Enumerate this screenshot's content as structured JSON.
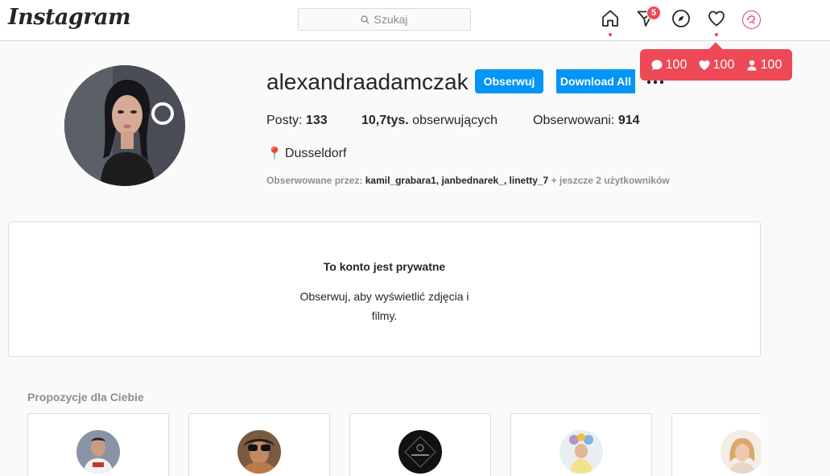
{
  "nav": {
    "logo": "Instagram",
    "search_placeholder": "Szukaj",
    "messages_badge": "5",
    "icons": [
      "home-icon",
      "direct-icon",
      "explore-icon",
      "activity-heart-icon",
      "profile-avatar-icon"
    ]
  },
  "activity_popup": {
    "comments": "100",
    "likes": "100",
    "follows": "100"
  },
  "profile": {
    "username": "alexandraadamczak",
    "follow_label": "Obserwuj",
    "download_label": "Download All",
    "posts_label": "Posty:",
    "posts_count": "133",
    "followers_count": "10,7tys.",
    "followers_label": "obserwujących",
    "following_label": "Obserwowani:",
    "following_count": "914",
    "location": "Dusseldorf",
    "followed_by_prefix": "Obserwowane przez:",
    "followed_by_users": [
      "kamil_grabara1",
      "janbednarek_",
      "linetty_7"
    ],
    "followed_by_suffix": "+ jeszcze 2 użytkowników"
  },
  "private": {
    "title": "To konto jest prywatne",
    "subtitle": "Obserwuj, aby wyświetlić zdjęcia i filmy."
  },
  "suggestions": {
    "title": "Propozycje dla Ciebie"
  },
  "colors": {
    "accent": "#0095f6",
    "notification": "#ed4956",
    "border": "#dbdbdb",
    "muted": "#8e8e8e"
  }
}
